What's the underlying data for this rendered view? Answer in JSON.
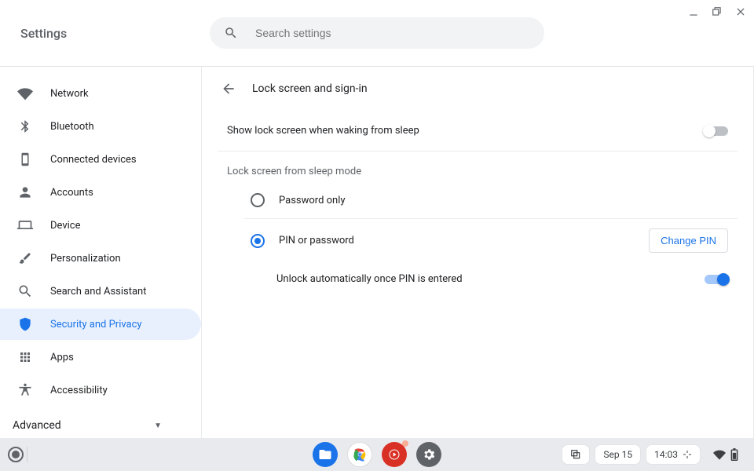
{
  "window": {
    "app_title": "Settings"
  },
  "search": {
    "placeholder": "Search settings"
  },
  "sidebar": {
    "items": [
      {
        "label": "Network"
      },
      {
        "label": "Bluetooth"
      },
      {
        "label": "Connected devices"
      },
      {
        "label": "Accounts"
      },
      {
        "label": "Device"
      },
      {
        "label": "Personalization"
      },
      {
        "label": "Search and Assistant"
      },
      {
        "label": "Security and Privacy"
      },
      {
        "label": "Apps"
      },
      {
        "label": "Accessibility"
      }
    ],
    "advanced_label": "Advanced"
  },
  "content": {
    "page_title": "Lock screen and sign-in",
    "show_lock_label": "Show lock screen when waking from sleep",
    "section_heading": "Lock screen from sleep mode",
    "option_password": "Password only",
    "option_pin": "PIN or password",
    "change_pin_label": "Change PIN",
    "auto_unlock_label": "Unlock automatically once PIN is entered"
  },
  "shelf": {
    "date": "Sep 15",
    "time": "14:03"
  }
}
